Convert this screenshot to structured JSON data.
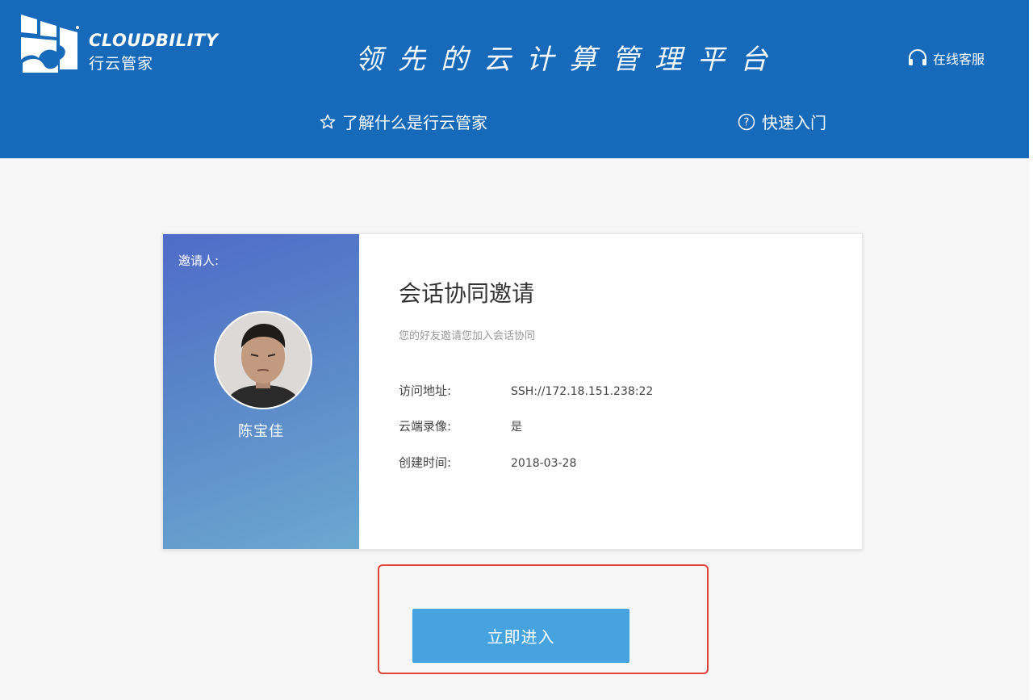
{
  "header": {
    "brand_en": "CLOUDBILITY",
    "brand_cn": "行云管家",
    "slogan": "领先的云计算管理平台",
    "service_label": "在线客服",
    "nav": [
      {
        "icon": "star-icon",
        "label": "了解什么是行云管家"
      },
      {
        "icon": "question-circle-icon",
        "label": "快速入门"
      }
    ]
  },
  "invite": {
    "inviter_label": "邀请人:",
    "inviter_name": "陈宝佳",
    "title": "会话协同邀请",
    "subtitle": "您的好友邀请您加入会话协同",
    "fields": [
      {
        "label": "访问地址:",
        "value": "SSH://172.18.151.238:22"
      },
      {
        "label": "云端录像:",
        "value": "是"
      },
      {
        "label": "创建时间:",
        "value": "2018-03-28"
      }
    ]
  },
  "action": {
    "enter_label": "立即进入"
  },
  "colors": {
    "header": "#1769b9",
    "button": "#47a2e0",
    "highlight": "#e0443a"
  }
}
